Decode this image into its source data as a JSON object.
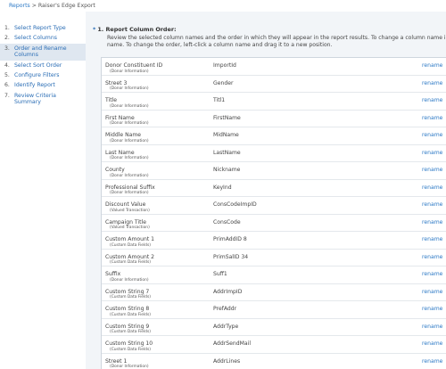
{
  "breadcrumb": {
    "root": "Reports",
    "separator": ">",
    "current": "Raiser's Edge Export"
  },
  "steps": [
    {
      "num": "1.",
      "label": "Select Report Type"
    },
    {
      "num": "2.",
      "label": "Select Columns"
    },
    {
      "num": "3.",
      "label": "Order and Rename Columns",
      "active": true
    },
    {
      "num": "4.",
      "label": "Select Sort Order"
    },
    {
      "num": "5.",
      "label": "Configure Filters"
    },
    {
      "num": "6.",
      "label": "Identify Report"
    },
    {
      "num": "7.",
      "label": "Review Criteria Summary"
    }
  ],
  "section": {
    "required_mark": "*",
    "title": "1. Report Column Order:",
    "description": "Review the selected column names and the order in which they will appear in the report results. To change a column name in the r new name. To change the order, left-click a column name and drag it to a new position."
  },
  "rename_label": "rename",
  "columns": [
    {
      "name": "Donor Constituent ID",
      "group": "(Donor Information)",
      "code": "ImportId"
    },
    {
      "name": "Street 3",
      "group": "(Donor Information)",
      "code": "Gender"
    },
    {
      "name": "Title",
      "group": "(Donor Information)",
      "code": "Titl1"
    },
    {
      "name": "First Name",
      "group": "(Donor Information)",
      "code": "FirstName"
    },
    {
      "name": "Middle Name",
      "group": "(Donor Information)",
      "code": "MidName"
    },
    {
      "name": "Last Name",
      "group": "(Donor Information)",
      "code": "LastName"
    },
    {
      "name": "County",
      "group": "(Donor Information)",
      "code": "Nickname"
    },
    {
      "name": "Professional Suffix",
      "group": "(Donor Information)",
      "code": "KeyInd"
    },
    {
      "name": "Discount Value",
      "group": "(Valued Transaction)",
      "code": "ConsCodeImpID"
    },
    {
      "name": "Campaign Title",
      "group": "(Valued Transaction)",
      "code": "ConsCode"
    },
    {
      "name": "Custom Amount 1",
      "group": "(Custom Data Fields)",
      "code": "PrimAddID 8"
    },
    {
      "name": "Custom Amount 2",
      "group": "(Custom Data Fields)",
      "code": "PrimSalID 34"
    },
    {
      "name": "Suffix",
      "group": "(Donor Information)",
      "code": "Suff1"
    },
    {
      "name": "Custom String 7",
      "group": "(Custom Data Fields)",
      "code": "AddrImpID"
    },
    {
      "name": "Custom String 8",
      "group": "(Custom Data Fields)",
      "code": "PrefAddr"
    },
    {
      "name": "Custom String 9",
      "group": "(Custom Data Fields)",
      "code": "AddrType"
    },
    {
      "name": "Custom String 10",
      "group": "(Custom Data Fields)",
      "code": "AddrSendMail"
    },
    {
      "name": "Street 1",
      "group": "(Donor Information)",
      "code": "AddrLines"
    }
  ]
}
